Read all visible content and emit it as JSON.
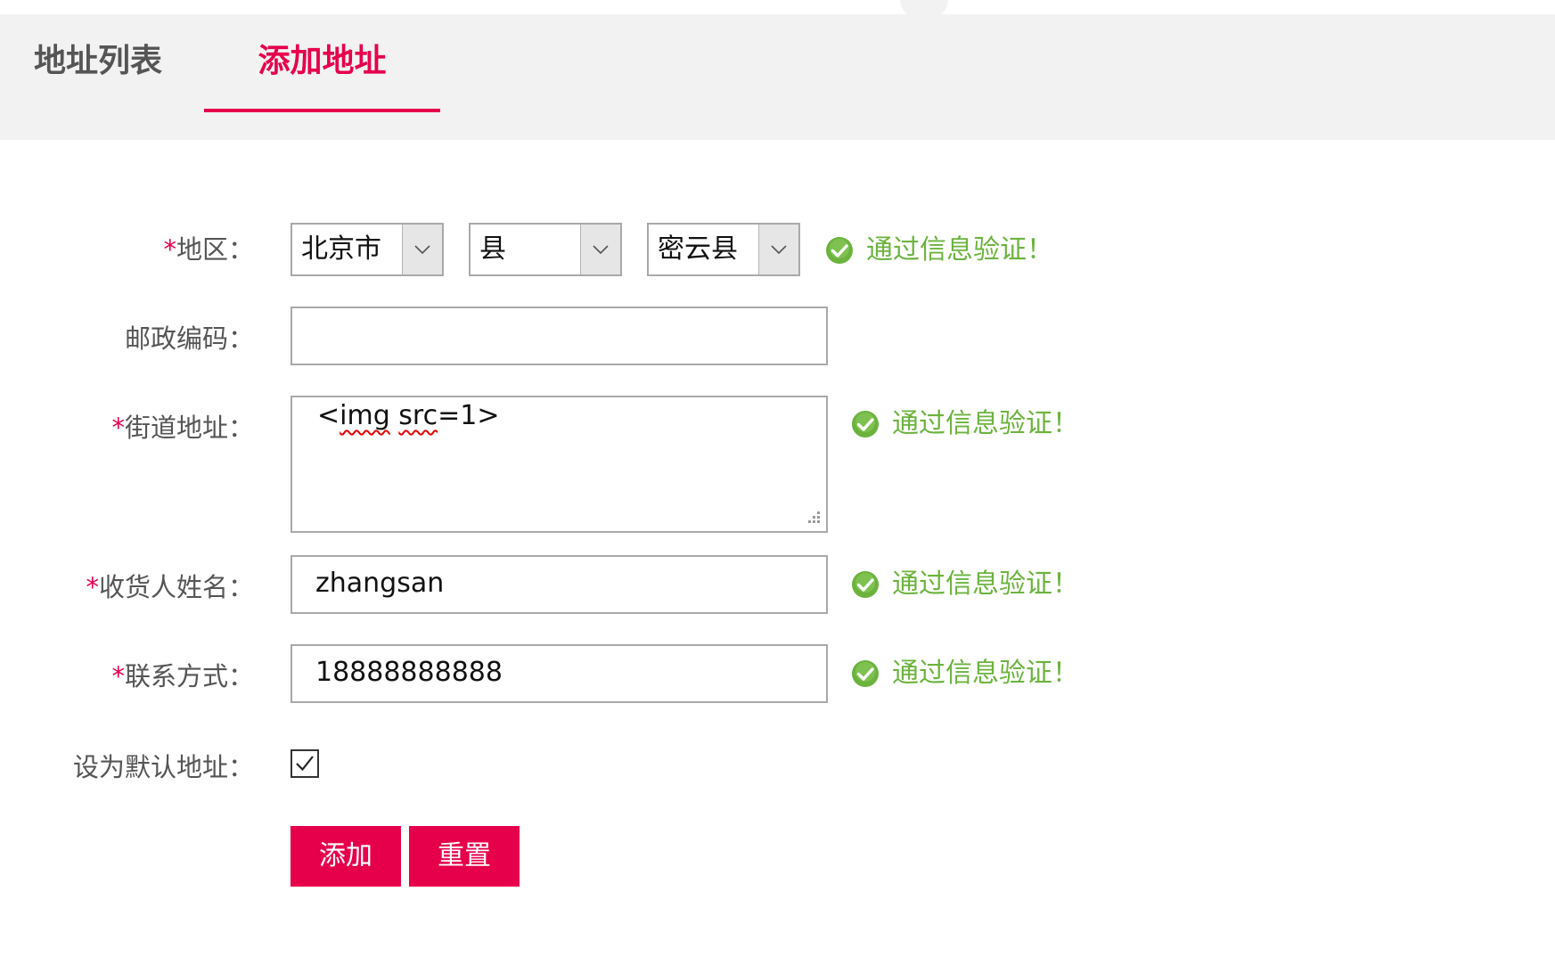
{
  "tabs": [
    {
      "label": "地址列表",
      "active": false
    },
    {
      "label": "添加地址",
      "active": true
    }
  ],
  "form": {
    "required_mark": "*",
    "region": {
      "label": "地区：",
      "province": "北京市",
      "city": "县",
      "district": "密云县"
    },
    "postcode": {
      "label": "邮政编码：",
      "value": ""
    },
    "street": {
      "label": "街道地址：",
      "value_part1": "<",
      "value_part2": "img",
      "value_part3": " ",
      "value_part4": "src",
      "value_part5": "=1>"
    },
    "name": {
      "label": "收货人姓名：",
      "value": "zhangsan"
    },
    "phone": {
      "label": "联系方式：",
      "value": "18888888888"
    },
    "default": {
      "label": "设为默认地址：",
      "checked": true
    },
    "validation_message": "通过信息验证！"
  },
  "buttons": {
    "add": "添加",
    "reset": "重置"
  },
  "colors": {
    "accent": "#e6004c",
    "valid": "#6cb33e",
    "tab_bg": "#f2f2f2",
    "label": "#555555"
  }
}
